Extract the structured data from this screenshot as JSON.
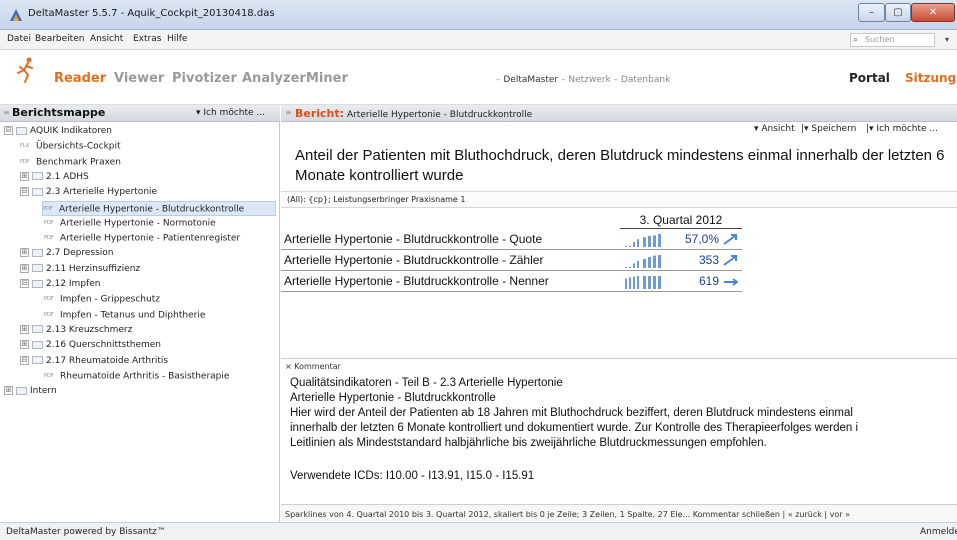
{
  "window": {
    "title": "DeltaMaster 5.5.7 - Aquik_Cockpit_20130418.das",
    "min": "–",
    "max": "▢",
    "close": "✕"
  },
  "menu": {
    "items": [
      "Datei",
      "Bearbeiten",
      "Ansicht",
      "Extras",
      "Hilfe"
    ],
    "search_placeholder": "Suchen",
    "search_drop": "▾"
  },
  "nav": {
    "modes": [
      "Reader",
      "Viewer",
      "Pivotizer",
      "Analyzer",
      "Miner"
    ],
    "crumb_prefix": "–",
    "crumb_current": "DeltaMaster",
    "crumb_rest": "– Netzwerk – Datenbank",
    "portal": "Portal",
    "sitzung": "Sitzung",
    "colors": {
      "active": "#e07020",
      "inactive": "#9a9a9a"
    }
  },
  "left": {
    "title": "Berichtsmappe",
    "collapse": "≡",
    "action": "▾ Ich möchte ...",
    "tree": [
      {
        "label": "AQUIK Indikatoren",
        "level": 0,
        "type": "root",
        "exp": "⊟"
      },
      {
        "label": "Übersichts-Cockpit",
        "level": 1,
        "type": "report",
        "icon": "FLX"
      },
      {
        "label": "Benchmark Praxen",
        "level": 1,
        "type": "report",
        "icon": "PDF"
      },
      {
        "label": "2.1 ADHS",
        "level": 1,
        "type": "folder",
        "exp": "⊞"
      },
      {
        "label": "2.3 Arterielle Hypertonie",
        "level": 1,
        "type": "folder",
        "exp": "⊟"
      },
      {
        "label": "Arterielle Hypertonie - Blutdruckkontrolle",
        "level": 2,
        "type": "report",
        "icon": "PDF",
        "selected": true
      },
      {
        "label": "Arterielle Hypertonie - Normotonie",
        "level": 2,
        "type": "report",
        "icon": "PDF"
      },
      {
        "label": "Arterielle Hypertonie - Patientenregister",
        "level": 2,
        "type": "report",
        "icon": "PDF"
      },
      {
        "label": "2.7 Depression",
        "level": 1,
        "type": "folder",
        "exp": "⊞"
      },
      {
        "label": "2.11 Herzinsuffizienz",
        "level": 1,
        "type": "folder",
        "exp": "⊞"
      },
      {
        "label": "2.12 Impfen",
        "level": 1,
        "type": "folder",
        "exp": "⊟"
      },
      {
        "label": "Impfen - Grippeschutz",
        "level": 2,
        "type": "report",
        "icon": "PDF"
      },
      {
        "label": "Impfen - Tetanus und Diphtherie",
        "level": 2,
        "type": "report",
        "icon": "PDF"
      },
      {
        "label": "2.13 Kreuzschmerz",
        "level": 1,
        "type": "folder",
        "exp": "⊞"
      },
      {
        "label": "2.16 Querschnittsthemen",
        "level": 1,
        "type": "folder",
        "exp": "⊞"
      },
      {
        "label": "2.17 Rheumatoide Arthritis",
        "level": 1,
        "type": "folder",
        "exp": "⊟"
      },
      {
        "label": "Rheumatoide Arthritis - Basistherapie",
        "level": 2,
        "type": "report",
        "icon": "PDF"
      },
      {
        "label": "Intern",
        "level": 0,
        "type": "folder",
        "exp": "⊞"
      }
    ]
  },
  "report": {
    "header_label": "Bericht:",
    "header_name": "Arterielle Hypertonie - Blutdruckkontrolle",
    "collapse": "≡",
    "toolbar": {
      "ansicht": "▾ Ansicht",
      "speichern": "|▾ Speichern",
      "ich": "|▾ Ich möchte ..."
    },
    "title": "Anteil der Patienten mit Bluthochdruck, deren Blutdruck mindestens einmal innerhalb der letzten 6 Monate kontrolliert wurde",
    "filter": "(All): {cp}; Leistungserbringer Praxisname 1",
    "column": "3. Quartal 2012",
    "rows": [
      {
        "label": "Arterielle Hypertonie - Blutdruckkontrolle - Quote",
        "value": "57,0%",
        "trend": "up",
        "spark": [
          0.05,
          0.1,
          0.4,
          0.6,
          0.75,
          0.85,
          0.9,
          1.0
        ]
      },
      {
        "label": "Arterielle Hypertonie - Blutdruckkontrolle - Zähler",
        "value": "353",
        "trend": "up",
        "spark": [
          0.05,
          0.1,
          0.35,
          0.55,
          0.7,
          0.85,
          0.95,
          1.0
        ]
      },
      {
        "label": "Arterielle Hypertonie - Blutdruckkontrolle - Nenner",
        "value": "619",
        "trend": "flat",
        "spark": [
          0.8,
          0.9,
          0.95,
          1.0,
          1.0,
          1.0,
          1.0,
          1.0
        ]
      }
    ],
    "spark_color": "#6e9bd4",
    "arrow_color": "#4a86d8"
  },
  "comment": {
    "header": "× Kommentar",
    "lines": [
      "Qualitätsindikatoren - Teil B - 2.3 Arterielle Hypertonie",
      "Arterielle Hypertonie - Blutdruckkontrolle",
      "Hier wird der Anteil der Patienten ab 18 Jahren mit Bluthochdruck beziffert, deren Blutdruck mindestens einmal",
      "innerhalb der letzten 6 Monate kontrolliert und dokumentiert wurde. Zur Kontrolle des Therapieerfolges werden i",
      "Leitlinien als Mindeststandard halbjährliche bis zweijährliche Blutdruckmessungen empfohlen.",
      "",
      "Verwendete ICDs: I10.00 - I13.91, I15.0 - I15.91"
    ]
  },
  "status": {
    "sparkline_info": "Sparklines von 4. Quartal 2010 bis 3. Quartal 2012, skaliert bis 0 je Zeile; 3 Zeilen, 1 Spalte, 27 Ele...   Kommentar schließen | « zurück | vor »",
    "left": "DeltaMaster powered by Bissantz™",
    "right": "Anmelden"
  }
}
